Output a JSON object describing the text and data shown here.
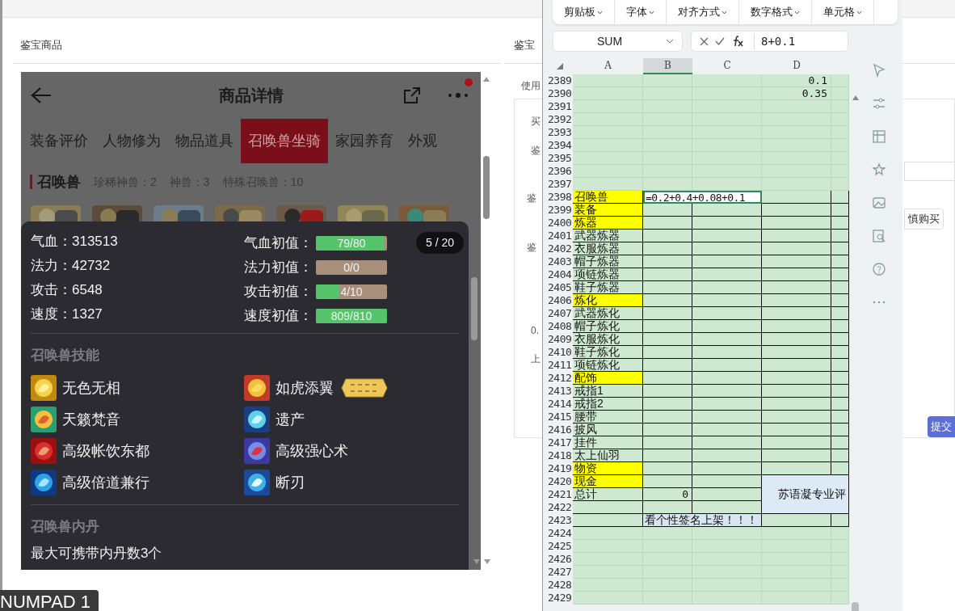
{
  "browser_page": {
    "section_title": "鉴宝商品",
    "side_title": "鉴宝",
    "side_fragments": [
      {
        "text": "使用"
      },
      {
        "text": "买"
      },
      {
        "text": "鉴"
      },
      {
        "text": "鉴"
      },
      {
        "text": "鉴"
      },
      {
        "text": "0."
      },
      {
        "text": "上"
      }
    ],
    "buttons": [
      {
        "label": "慎购买",
        "kind": "outline"
      },
      {
        "label": "提交",
        "kind": "primary"
      }
    ]
  },
  "phone": {
    "title": "商品详情",
    "notification": true,
    "tabs": [
      {
        "label": "装备评价",
        "selected": false
      },
      {
        "label": "人物修为",
        "selected": false
      },
      {
        "label": "物品道具",
        "selected": false
      },
      {
        "label": "召唤兽坐骑",
        "selected": true
      },
      {
        "label": "家园养育",
        "selected": false
      },
      {
        "label": "外观",
        "selected": false
      }
    ],
    "section": {
      "title": "召唤兽",
      "summary": [
        "珍稀神兽：2",
        "神兽：3",
        "特殊召唤兽：10"
      ]
    },
    "popup": {
      "counter": "5 / 20",
      "stats": [
        {
          "text": "气血：313513"
        },
        {
          "text": "法力：42732"
        },
        {
          "text": "攻击：6548"
        },
        {
          "text": "速度：1327"
        }
      ],
      "aptitudes": [
        {
          "label": "气血初值：",
          "reading": "79/80",
          "level": 0.96
        },
        {
          "label": "法力初值：",
          "reading": "0/0",
          "level": 0
        },
        {
          "label": "攻击初值：",
          "reading": "4/10",
          "level": 0.33
        },
        {
          "label": "速度初值：",
          "reading": "809/810",
          "level": 1
        }
      ],
      "skills_title": "召唤兽技能",
      "skills": [
        {
          "name": "无色无相",
          "badge": false
        },
        {
          "name": "如虎添翼",
          "badge": true
        },
        {
          "name": "天籁梵音",
          "badge": false
        },
        {
          "name": "遗产",
          "badge": false
        },
        {
          "name": "高级帐饮东都",
          "badge": false
        },
        {
          "name": "高级强心术",
          "badge": false
        },
        {
          "name": "高级倍道兼行",
          "badge": false
        },
        {
          "name": "断刃",
          "badge": false
        }
      ],
      "core_title": "召唤兽内丹",
      "core_text": "最大可携带内丹数3个"
    }
  },
  "spreadsheet": {
    "ribbon_groups": [
      "剪贴板",
      "字体",
      "对齐方式",
      "数字格式",
      "单元格"
    ],
    "name_box": "SUM",
    "formula": "8+0.1",
    "columns": [
      {
        "label": "A",
        "selected": false
      },
      {
        "label": "B",
        "selected": true
      },
      {
        "label": "C",
        "selected": false
      },
      {
        "label": "D",
        "selected": false
      }
    ],
    "rows": [
      {
        "number": "2389",
        "boxed": false,
        "d": {
          "text": "0.1",
          "kind": "number"
        }
      },
      {
        "number": "2390",
        "boxed": false,
        "d": {
          "text": "0.35",
          "kind": "number"
        }
      },
      {
        "number": "2391",
        "boxed": false
      },
      {
        "number": "2392",
        "boxed": false
      },
      {
        "number": "2393",
        "boxed": false
      },
      {
        "number": "2394",
        "boxed": false
      },
      {
        "number": "2395",
        "boxed": false
      },
      {
        "number": "2396",
        "boxed": false
      },
      {
        "number": "2397",
        "boxed": false
      },
      {
        "number": "2398",
        "boxed": true,
        "a": {
          "text": "召唤兽",
          "kind": "label",
          "highlighted": true
        },
        "b": {
          "text": "=0.2+0.4+0.08+0.1",
          "kind": "editor"
        }
      },
      {
        "number": "2399",
        "boxed": true,
        "a": {
          "text": "装备",
          "kind": "label",
          "highlighted": true
        }
      },
      {
        "number": "2400",
        "boxed": true,
        "a": {
          "text": "炼器",
          "kind": "label",
          "highlighted": true
        }
      },
      {
        "number": "2401",
        "boxed": true,
        "a": {
          "text": "武器炼器",
          "kind": "label",
          "highlighted": false
        }
      },
      {
        "number": "2402",
        "boxed": true,
        "a": {
          "text": "衣服炼器",
          "kind": "label",
          "highlighted": false
        }
      },
      {
        "number": "2403",
        "boxed": true,
        "a": {
          "text": "帽子炼器",
          "kind": "label",
          "highlighted": false
        }
      },
      {
        "number": "2404",
        "boxed": true,
        "a": {
          "text": "项链炼器",
          "kind": "label",
          "highlighted": false
        }
      },
      {
        "number": "2405",
        "boxed": true,
        "a": {
          "text": "鞋子炼器",
          "kind": "label",
          "highlighted": false
        }
      },
      {
        "number": "2406",
        "boxed": true,
        "a": {
          "text": "炼化",
          "kind": "label",
          "highlighted": true
        }
      },
      {
        "number": "2407",
        "boxed": true,
        "a": {
          "text": "武器炼化",
          "kind": "label",
          "highlighted": false
        }
      },
      {
        "number": "2408",
        "boxed": true,
        "a": {
          "text": "帽子炼化",
          "kind": "label",
          "highlighted": false
        }
      },
      {
        "number": "2409",
        "boxed": true,
        "a": {
          "text": "衣服炼化",
          "kind": "label",
          "highlighted": false
        }
      },
      {
        "number": "2410",
        "boxed": true,
        "a": {
          "text": "鞋子炼化",
          "kind": "label",
          "highlighted": false
        }
      },
      {
        "number": "2411",
        "boxed": true,
        "a": {
          "text": "项链炼化",
          "kind": "label",
          "highlighted": false
        }
      },
      {
        "number": "2412",
        "boxed": true,
        "a": {
          "text": "配饰",
          "kind": "label",
          "highlighted": true
        }
      },
      {
        "number": "2413",
        "boxed": true,
        "a": {
          "text": "戒指1",
          "kind": "label",
          "highlighted": false
        }
      },
      {
        "number": "2414",
        "boxed": true,
        "a": {
          "text": "戒指2",
          "kind": "label",
          "highlighted": false
        }
      },
      {
        "number": "2415",
        "boxed": true,
        "a": {
          "text": "腰带",
          "kind": "label",
          "highlighted": false
        }
      },
      {
        "number": "2416",
        "boxed": true,
        "a": {
          "text": "披风",
          "kind": "label",
          "highlighted": false
        }
      },
      {
        "number": "2417",
        "boxed": true,
        "a": {
          "text": "挂件",
          "kind": "label",
          "highlighted": false
        }
      },
      {
        "number": "2418",
        "boxed": true,
        "a": {
          "text": "太上仙羽",
          "kind": "label",
          "highlighted": false
        }
      },
      {
        "number": "2419",
        "boxed": true,
        "a": {
          "text": "物资",
          "kind": "label",
          "highlighted": true
        }
      },
      {
        "number": "2420",
        "boxed": true,
        "a": {
          "text": "现金",
          "kind": "label",
          "highlighted": true
        },
        "d": {
          "text": "苏语凝专业评",
          "kind": "merged"
        }
      },
      {
        "number": "2421",
        "boxed": true,
        "a": {
          "text": "总计",
          "kind": "label",
          "highlighted": false
        },
        "b": {
          "text": "0",
          "kind": "number"
        }
      },
      {
        "number": "2422",
        "boxed": true
      },
      {
        "number": "2423",
        "boxed": true,
        "b": {
          "text": "看个性签名上架！！！",
          "kind": "caption"
        }
      },
      {
        "number": "2424",
        "boxed": false
      },
      {
        "number": "2425",
        "boxed": false
      },
      {
        "number": "2426",
        "boxed": false
      },
      {
        "number": "2427",
        "boxed": false
      },
      {
        "number": "2428",
        "boxed": false
      },
      {
        "number": "2429",
        "boxed": false
      }
    ]
  },
  "key_overlay": "NUMPAD 1"
}
